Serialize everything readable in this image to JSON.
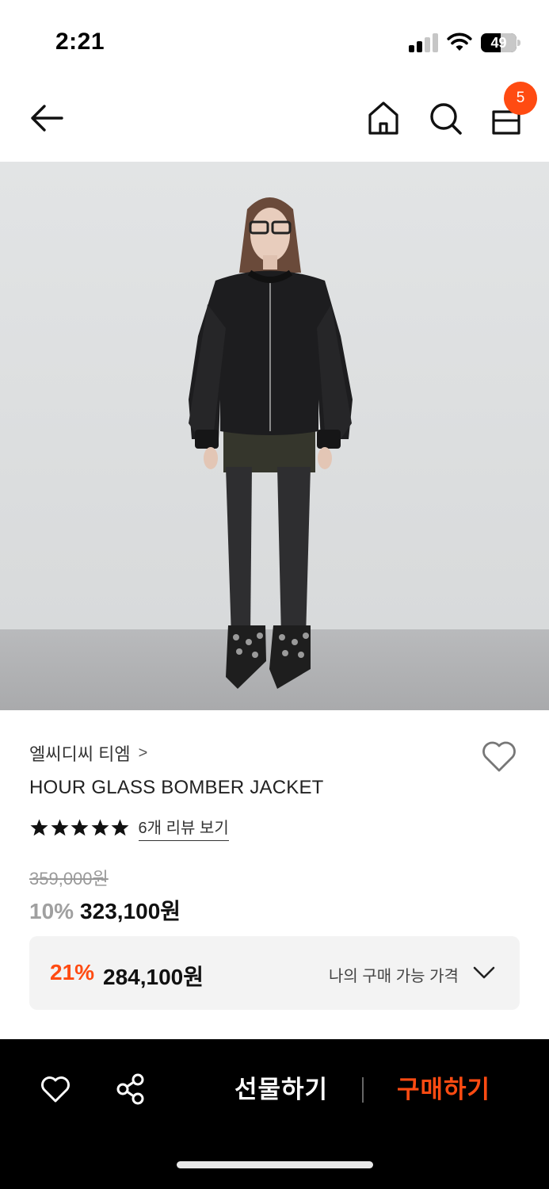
{
  "status_bar": {
    "time": "2:21",
    "battery": "49"
  },
  "nav": {
    "cart_count": "5"
  },
  "product": {
    "brand": "엘씨디씨 티엠",
    "brand_chevron": ">",
    "title": "HOUR GLASS BOMBER JACKET",
    "rating_stars": 5,
    "review_link": "6개 리뷰 보기",
    "original_price": "359,000원",
    "sale_rate": "10%",
    "sale_price": "323,100원"
  },
  "my_price": {
    "rate": "21%",
    "price": "284,100원",
    "label": "나의 구매 가능 가격"
  },
  "bottom_bar": {
    "gift_label": "선물하기",
    "buy_label": "구매하기"
  },
  "colors": {
    "accent": "#ff4b12",
    "bar": "#000000"
  }
}
